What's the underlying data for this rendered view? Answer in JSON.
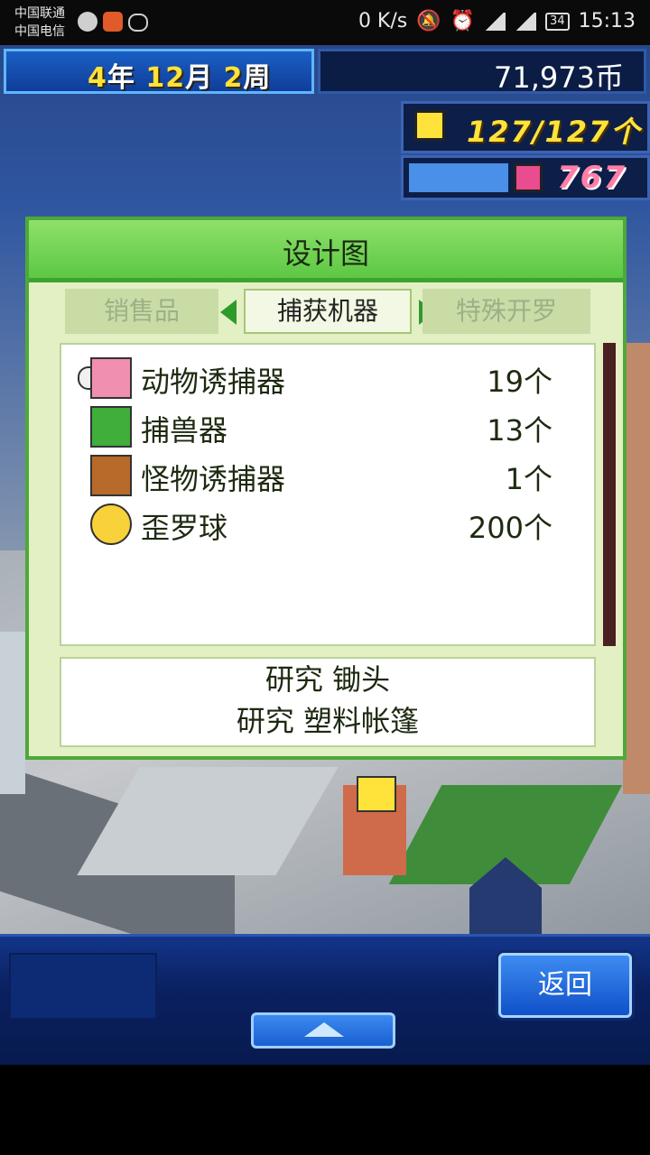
{
  "status_bar": {
    "carrier_1": "中国联通",
    "carrier_2": "中国电信",
    "net_speed": "0 K/s",
    "battery": "34",
    "time": "15:13"
  },
  "top_bar": {
    "date": {
      "year": "4",
      "year_unit": "年",
      "month": "12",
      "month_unit": "月",
      "week": "2",
      "week_unit": "周"
    },
    "money": "71,973币",
    "population": "127/127个",
    "research_points": "767"
  },
  "dialog": {
    "title": "设计图",
    "tabs": [
      {
        "label": "销售品",
        "selected": false
      },
      {
        "label": "捕获机器",
        "selected": true
      },
      {
        "label": "特殊开罗",
        "selected": false
      }
    ],
    "items": [
      {
        "name": "动物诱捕器",
        "count": "19个",
        "icon": "bone-icon"
      },
      {
        "name": "捕兽器",
        "count": "13个",
        "icon": "green-cage-icon"
      },
      {
        "name": "怪物诱捕器",
        "count": "1个",
        "icon": "meat-icon"
      },
      {
        "name": "歪罗球",
        "count": "200个",
        "icon": "smiley-ball-icon"
      }
    ],
    "research": [
      "研究 锄头",
      "研究 塑料帐篷"
    ]
  },
  "bottom": {
    "back_label": "返回"
  },
  "colors": {
    "dialog_header": "#5cc844",
    "date_text": "#ffe23a",
    "points_text": "#ff7fa8"
  }
}
